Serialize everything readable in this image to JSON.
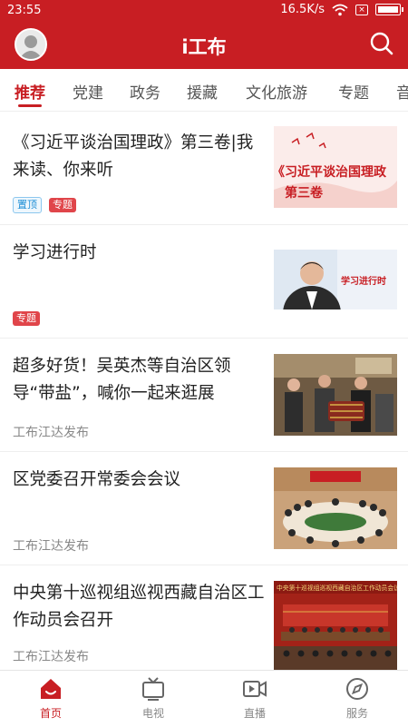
{
  "status_bar": {
    "time": "23:55",
    "net_speed": "16.5K/s"
  },
  "app": {
    "title": "i工布"
  },
  "tabs": [
    {
      "label": "推荐",
      "active": true
    },
    {
      "label": "党建"
    },
    {
      "label": "政务"
    },
    {
      "label": "援藏"
    },
    {
      "label": "文化旅游"
    },
    {
      "label": "专题"
    },
    {
      "label": "音"
    }
  ],
  "feed": [
    {
      "title": "《习近平谈治国理政》第三卷|我来读、你来听",
      "tags": [
        "置顶",
        "专题"
      ],
      "source": "",
      "thumb": {
        "line1": "《习近平谈治国理政",
        "line2": "第三卷"
      }
    },
    {
      "title": "学习进行时",
      "tags": [
        "专题"
      ],
      "source": "",
      "thumb": {
        "line1": "学习进行时"
      }
    },
    {
      "title": "超多好货！吴英杰等自治区领导“带盐”，喊你一起来逛展",
      "tags": [],
      "source": "工布江达发布"
    },
    {
      "title": "区党委召开常委会会议",
      "tags": [],
      "source": "工布江达发布"
    },
    {
      "title": "中央第十巡视组巡视西藏自治区工作动员会召开",
      "tags": [],
      "source": "工布江达发布",
      "thumb": {
        "line1": "中央第十巡视组巡视西藏自治区工作动员会议"
      }
    }
  ],
  "bottom_nav": [
    {
      "label": "首页",
      "icon": "home-icon",
      "active": true
    },
    {
      "label": "电视",
      "icon": "tv-icon"
    },
    {
      "label": "直播",
      "icon": "live-icon"
    },
    {
      "label": "服务",
      "icon": "compass-icon"
    }
  ],
  "colors": {
    "brand": "#c81e23",
    "tag_top": "#1f8fd6",
    "tag_special": "#e0454a"
  }
}
